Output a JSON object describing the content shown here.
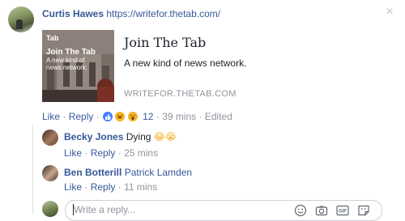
{
  "post": {
    "author": "Curtis Hawes",
    "url": "https://writefor.thetab.com/"
  },
  "card": {
    "thumb_logo": "Tab",
    "thumb_title": "Join The Tab",
    "thumb_sub": "A new kind of news network.",
    "title": "Join The Tab",
    "description": "A new kind of news network.",
    "domain": "WRITEFOR.THETAB.COM"
  },
  "actions": {
    "like": "Like",
    "reply": "Reply",
    "reaction_count": "12",
    "time": "39 mins",
    "edited": "Edited",
    "sep": "·"
  },
  "replies": [
    {
      "author": "Becky Jones",
      "text": "Dying",
      "emoji": "😂😭",
      "like": "Like",
      "reply": "Reply",
      "time": "25 mins"
    },
    {
      "author": "Ben Botterill",
      "text": "Patrick Lamden",
      "emoji": "",
      "like": "Like",
      "reply": "Reply",
      "time": "11 mins"
    }
  ],
  "composer": {
    "placeholder": "Write a reply..."
  },
  "colors": {
    "link": "#365899",
    "muted": "#90949c",
    "like_blue": "#4080ff",
    "haha_yellow": "#f7b125"
  },
  "icons": [
    "close-icon",
    "like-reaction-icon",
    "haha-reaction-icon",
    "wow-reaction-icon",
    "emoji-icon",
    "camera-icon",
    "gif-icon",
    "sticker-icon"
  ]
}
